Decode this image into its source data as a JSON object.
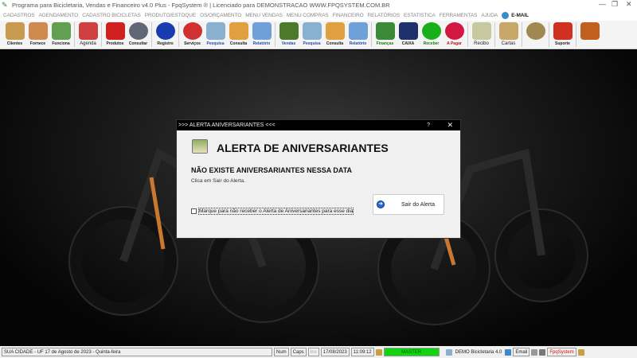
{
  "window": {
    "title": "Programa para Bicicletaria, Vendas e Financeiro v4.0 Plus - FpqSystem ® | Licenciado para  DEMONSTRACAO WWW.FPQSYSTEM.COM.BR",
    "minimize": "—",
    "maximize": "❐",
    "close": "✕"
  },
  "menu": [
    "CADASTROS",
    "AGENDAMENTO",
    "CADASTRO BICICLETAS",
    "PRODUTO/ESTOQUE",
    "OS/ORÇAMENTO",
    "MENU VENDAS",
    "MENU COMPRAS",
    "FINANCEIRO",
    "RELATÓRIOS",
    "ESTATISTICA",
    "FERRAMENTAS",
    "AJUDA"
  ],
  "menu_email": "E-MAIL",
  "toolbar": [
    {
      "label": "Clientes",
      "icon": "clients-icon",
      "color": "#c89a50"
    },
    {
      "label": "Fornece",
      "icon": "supplier-icon",
      "color": "#d08a50"
    },
    {
      "label": "Funciona",
      "icon": "employee-icon",
      "color": "#60a050"
    },
    {
      "label": "Agenda",
      "icon": "calendar-icon",
      "color": "#d04040"
    },
    {
      "label": "Produtos",
      "icon": "toolbox-icon",
      "color": "#d02020"
    },
    {
      "label": "Consultar",
      "icon": "barcode-icon",
      "color": "#606878"
    },
    {
      "label": "Registro",
      "icon": "bicycle-icon",
      "color": "#1a3ab0"
    },
    {
      "label": "Serviços",
      "icon": "bike-service-icon",
      "color": "#d03030"
    },
    {
      "label": "Pesquisa",
      "icon": "search-doc-icon",
      "color": "#8ab0d0"
    },
    {
      "label": "Consulta",
      "icon": "folder-icon",
      "color": "#e0a040"
    },
    {
      "label": "Relatório",
      "icon": "printer-icon",
      "color": "#70a0d8"
    },
    {
      "label": "Vendas",
      "icon": "cart-icon",
      "color": "#4a7a2a"
    },
    {
      "label": "Pesquisa",
      "icon": "search-doc-icon",
      "color": "#8ab0d0"
    },
    {
      "label": "Consulta",
      "icon": "folder-icon",
      "color": "#e0a040"
    },
    {
      "label": "Relatório",
      "icon": "printer-icon",
      "color": "#70a0d8"
    },
    {
      "label": "Finanças",
      "icon": "finance-icon",
      "color": "#3a8a3a"
    },
    {
      "label": "CAIXA",
      "icon": "cashbook-icon",
      "color": "#20306a"
    },
    {
      "label": "Receber",
      "icon": "receive-money-icon",
      "color": "#18b018"
    },
    {
      "label": "A Pagar",
      "icon": "pay-money-icon",
      "color": "#d01840"
    },
    {
      "label": "Recibo",
      "icon": "receipt-icon",
      "color": "#c8c8a0"
    },
    {
      "label": "Cartas",
      "icon": "letter-icon",
      "color": "#c8a868"
    },
    {
      "label": "",
      "icon": "coins-icon",
      "color": "#a08850"
    },
    {
      "label": "Suporte",
      "icon": "support-icon",
      "color": "#d03020"
    },
    {
      "label": "",
      "icon": "exit-door-icon",
      "color": "#c06020"
    }
  ],
  "dialog": {
    "title": ">>> ALERTA ANIVERSARIANTES <<<",
    "help": "?",
    "close": "✕",
    "heading": "ALERTA DE ANIVERSARIANTES",
    "message": "NÃO EXISTE ANIVERSARIANTES NESSA DATA",
    "hint": "Clica em Sair do Alerta.",
    "checkbox_label": "Marque para não receber o Alerta de Aniversariantes para esse dia",
    "checkbox_checked": false,
    "exit_button": "Sair do Alerta"
  },
  "status": {
    "location": "SUA CIDADE - UF 17 de Agosto de 2023 - Quinta-feira",
    "num": "Num",
    "caps": "Caps",
    "ins": "Ins",
    "date": "17/08/2023",
    "time": "11:09:12",
    "user": "MASTER",
    "company": "DEMO Bicicletaria 4.0",
    "email": "Email",
    "brand": "FpqSystem"
  }
}
